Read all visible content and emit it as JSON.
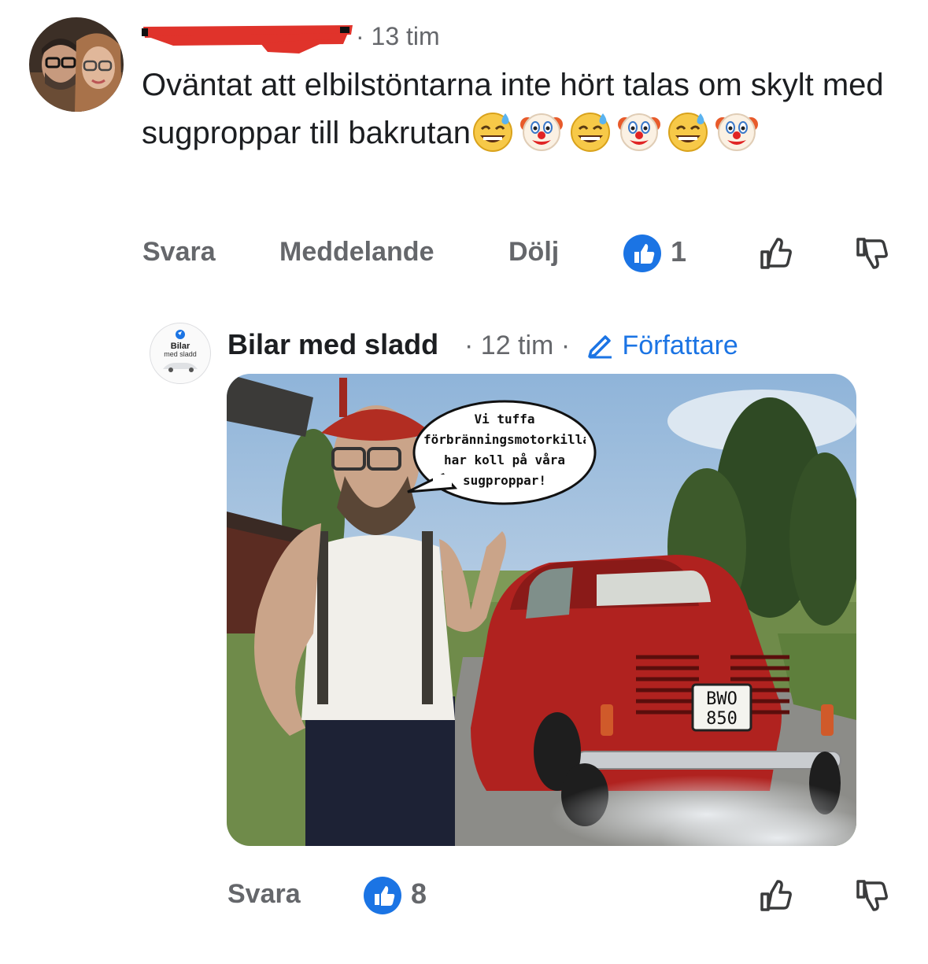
{
  "comment": {
    "author": "",
    "time": "13 tim",
    "text": "Oväntat att elbilstöntarna inte hört talas om skylt med sugproppar till bakrutan",
    "emojis": [
      "sweat-smile",
      "clown",
      "sweat-smile",
      "clown",
      "sweat-smile",
      "clown"
    ],
    "actions": {
      "reply": "Svara",
      "message": "Meddelande",
      "hide": "Dölj"
    },
    "like_count": "1"
  },
  "reply": {
    "author": "Bilar med sladd",
    "time": "12 tim",
    "author_badge": "Författare",
    "avatar_text": {
      "line1": "Bilar",
      "line2": "med sladd"
    },
    "image": {
      "speech_bubble": "Vi tuffa förbränningsmotorkillar har koll på våra sugproppar!",
      "plate_line1": "BWO",
      "plate_line2": "850"
    },
    "actions": {
      "reply": "Svara"
    },
    "like_count": "8"
  },
  "colors": {
    "accent": "#1b74e4",
    "muted": "#65676b",
    "text": "#1c1e21",
    "redaction": "#e0332b"
  }
}
